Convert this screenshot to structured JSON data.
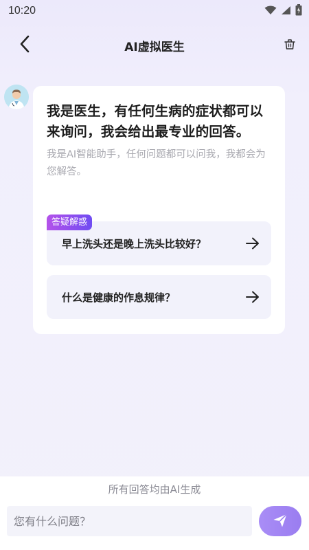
{
  "status_bar": {
    "time": "10:20",
    "icons": [
      "wifi-icon",
      "signal-icon",
      "battery-icon"
    ]
  },
  "header": {
    "title": "AI虚拟医生",
    "back_icon": "chevron-left-icon",
    "clear_icon": "trash-icon"
  },
  "chat": {
    "avatar_icon": "doctor-avatar",
    "title": "我是医生，有任何生病的症状都可以来询问，我会给出最专业的回答。",
    "subtitle": "我是AI智能助手，任何问题都可以问我，我都会为您解答。",
    "faq_tag": "答疑解惑",
    "questions": [
      {
        "text": "早上洗头还是晚上洗头比较好？",
        "icon": "arrow-right-icon"
      },
      {
        "text": "什么是健康的作息规律？",
        "icon": "arrow-right-icon"
      }
    ]
  },
  "footer": {
    "disclaimer": "所有回答均由AI生成",
    "input_placeholder": "您有什么问题？",
    "send_icon": "send-icon"
  },
  "colors": {
    "accent_start": "#b452ea",
    "accent_end": "#6f4cf2",
    "send_button": "#a48af5",
    "card_bg": "#f2f2fb"
  }
}
